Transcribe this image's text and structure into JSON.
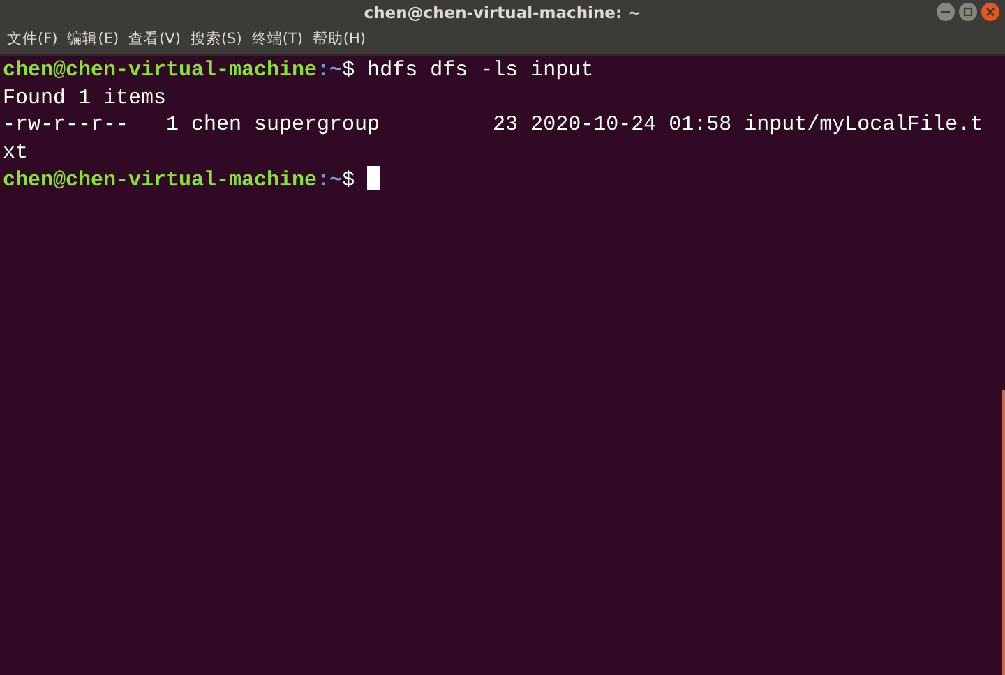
{
  "window": {
    "title": "chen@chen-virtual-machine: ~"
  },
  "menu": [
    {
      "label": "文件(F)"
    },
    {
      "label": "编辑(E)"
    },
    {
      "label": "查看(V)"
    },
    {
      "label": "搜索(S)"
    },
    {
      "label": "终端(T)"
    },
    {
      "label": "帮助(H)"
    }
  ],
  "terminal": {
    "lines": [
      {
        "kind": "prompt",
        "user_host": "chen@chen-virtual-machine",
        "path": ":~",
        "symbol": "$",
        "command": "hdfs dfs -ls input",
        "cursor": false
      },
      {
        "kind": "output",
        "text": "Found 1 items"
      },
      {
        "kind": "output",
        "text": "-rw-r--r--   1 chen supergroup         23 2020-10-24 01:58 input/myLocalFile.t"
      },
      {
        "kind": "output",
        "text": "xt"
      },
      {
        "kind": "prompt",
        "user_host": "chen@chen-virtual-machine",
        "path": ":~",
        "symbol": "$",
        "cursor": true
      }
    ]
  }
}
